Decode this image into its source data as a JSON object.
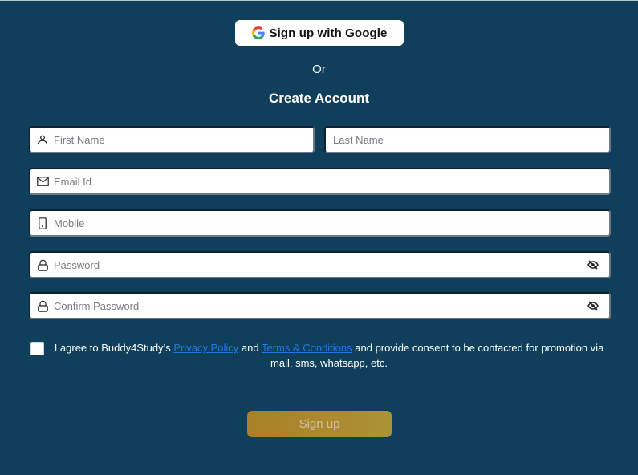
{
  "google": {
    "label": "Sign up with Google",
    "icon": "google-g-icon"
  },
  "separator": "Or",
  "title": "Create Account",
  "fields": {
    "first_name": {
      "placeholder": "First Name",
      "value": "",
      "icon": "user-icon"
    },
    "last_name": {
      "placeholder": "Last Name",
      "value": ""
    },
    "email": {
      "placeholder": "Email Id",
      "value": "",
      "icon": "envelope-icon"
    },
    "mobile": {
      "placeholder": "Mobile",
      "value": "",
      "icon": "phone-icon"
    },
    "password": {
      "placeholder": "Password",
      "value": "",
      "icon": "lock-icon",
      "toggle_icon": "eye-slash-icon"
    },
    "confirm_password": {
      "placeholder": "Confirm Password",
      "value": "",
      "icon": "lock-icon",
      "toggle_icon": "eye-slash-icon"
    }
  },
  "agreement": {
    "checked": false,
    "prefix": "I agree to Buddy4Study’s ",
    "privacy_link": "Privacy Policy",
    "middle": " and ",
    "terms_link": "Terms & Conditions",
    "suffix": " and provide consent to be contacted for promotion via mail, sms, whatsapp, etc."
  },
  "submit": {
    "label": "Sign up"
  },
  "colors": {
    "background": "#0f3f5a",
    "link": "#1f7ae0",
    "submit_gold": "#a98025"
  }
}
